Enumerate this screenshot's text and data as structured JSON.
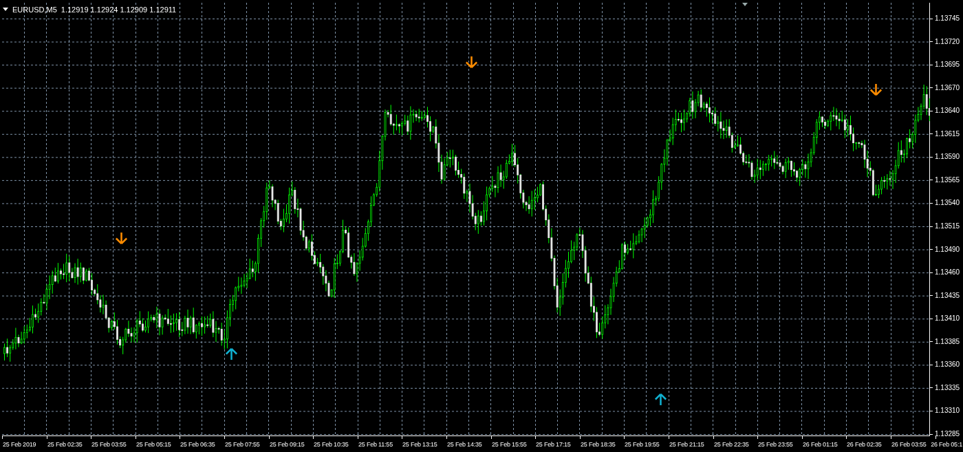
{
  "chart_header": {
    "symbol": "EURUSD,M5",
    "quotes": "1.12919 1.12924 1.12909 1.12911"
  },
  "price_axis": [
    "1.13745",
    "1.13720",
    "1.13695",
    "1.13670",
    "1.13640",
    "1.13615",
    "1.13590",
    "1.13565",
    "1.13540",
    "1.13515",
    "1.13490",
    "1.13460",
    "1.13435",
    "1.13410",
    "1.13385",
    "1.13360",
    "1.13335",
    "1.13310",
    "1.13285"
  ],
  "time_axis": [
    "25 Feb 2019",
    "25 Feb 02:35",
    "25 Feb 03:55",
    "25 Feb 05:15",
    "25 Feb 06:35",
    "25 Feb 07:55",
    "25 Feb 09:15",
    "25 Feb 10:35",
    "25 Feb 11:55",
    "25 Feb 13:15",
    "25 Feb 14:35",
    "25 Feb 15:55",
    "25 Feb 17:15",
    "25 Feb 18:35",
    "25 Feb 19:55",
    "25 Feb 21:15",
    "25 Feb 22:35",
    "25 Feb 23:55",
    "26 Feb 01:15",
    "26 Feb 02:35",
    "26 Feb 03:55",
    "26 Feb 05:1"
  ],
  "signals": [
    {
      "kind": "sell"
    },
    {
      "kind": "buy"
    },
    {
      "kind": "sell"
    },
    {
      "kind": "buy"
    },
    {
      "kind": "sell"
    }
  ]
}
